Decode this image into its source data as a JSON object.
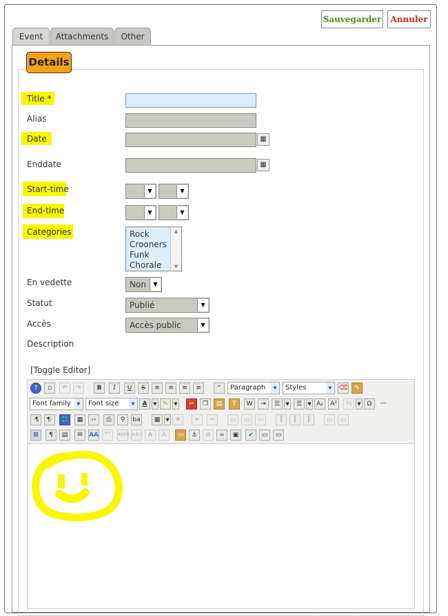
{
  "toolbar": {
    "save_label": "Sauvegarder",
    "cancel_label": "Annuler"
  },
  "tabs": [
    "Event",
    "Attachments",
    "Other"
  ],
  "fieldset": {
    "legend": "Details"
  },
  "fields": {
    "title": "Title *",
    "alias": "Alias",
    "date": "Date",
    "enddate": "Enddate",
    "starttime": "Start-time",
    "endtime": "End-time",
    "categories": "Categories",
    "featured": "En vedette",
    "status": "Statut",
    "access": "Accès",
    "description": "Description"
  },
  "categories_options": [
    "Rock",
    "Crooners",
    "Funk",
    "Chorale"
  ],
  "featured_value": "Non",
  "status_value": "Publié",
  "access_value": "Accès public",
  "editor": {
    "toggle": "[Toggle Editor]",
    "format_value": "Paragraph",
    "styles_value": "Styles",
    "font_family": "Font family",
    "font_size": "Font size"
  },
  "icons": {
    "calendar": "calendar-icon",
    "dropdown": "chevron-down-icon",
    "smiley": "smiley-drawing"
  },
  "colors": {
    "highlight": "#f9f600",
    "legend_bg": "#f7a11a",
    "save_text": "#5a8a1a",
    "cancel_text": "#c03018",
    "input_bg": "#c8ccc0",
    "focus_bg": "#dcedfb"
  }
}
